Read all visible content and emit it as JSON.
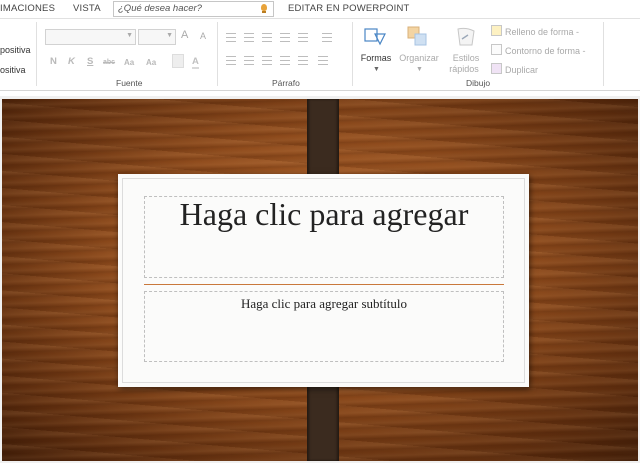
{
  "tabs": {
    "animaciones": "IMACIONES",
    "vista": "VISTA",
    "editar_ppt": "EDITAR EN POWERPOINT"
  },
  "search": {
    "text": "¿Qué desea hacer?"
  },
  "ribbon": {
    "left_items": [
      "positiva",
      "ositiva"
    ],
    "font": {
      "label": "Fuente",
      "grow": "A",
      "shrink": "A",
      "buttons": {
        "bold": "N",
        "italic": "K",
        "strike": "S",
        "abc": "abc",
        "aa": "Aa"
      },
      "font_color": "A"
    },
    "paragraph": {
      "label": "Párrafo"
    },
    "drawing": {
      "label": "Dibujo",
      "formas": "Formas",
      "organizar": "Organizar",
      "estilos_1": "Estilos",
      "estilos_2": "rápidos",
      "relleno": "Relleno de forma",
      "contorno": "Contorno de forma",
      "duplicar": "Duplicar"
    }
  },
  "slide": {
    "title": "Haga clic para agregar",
    "subtitle": "Haga clic para agregar subtítulo"
  },
  "colors": {
    "accent": "#c9783b",
    "wood": "#8f4b1c",
    "strap": "#3b2b1f"
  }
}
